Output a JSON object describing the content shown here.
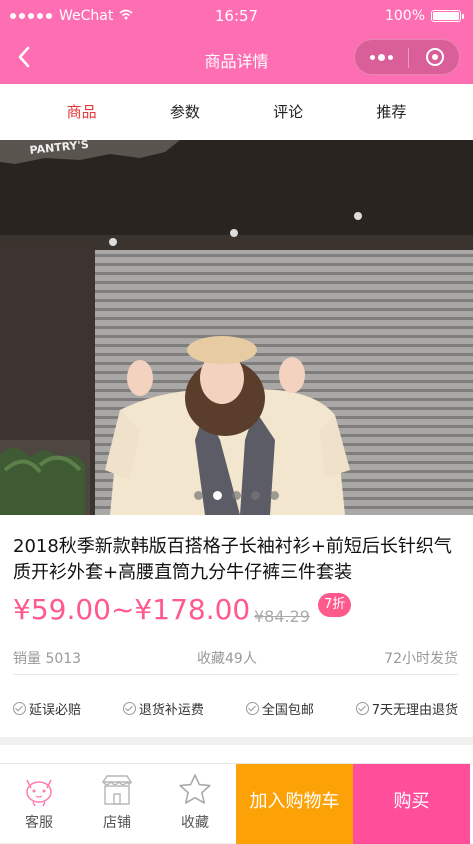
{
  "status": {
    "carrier": "WeChat",
    "time": "16:57",
    "battery": "100%"
  },
  "nav": {
    "title": "商品详情"
  },
  "tabs": [
    {
      "label": "商品"
    },
    {
      "label": "参数"
    },
    {
      "label": "评论"
    },
    {
      "label": "推荐"
    }
  ],
  "carousel": {
    "image_sign_text": "PANTRY'S",
    "slide_count": 5,
    "active_index": 1
  },
  "product": {
    "title": "2018秋季新款韩版百搭格子长袖衬衫+前短后长针织气质开衫外套+高腰直筒九分牛仔裤三件套装",
    "price": "¥59.00~¥178.00",
    "old_price": "¥84.29",
    "discount": "7折",
    "sales": "销量 5013",
    "favorites": "收藏49人",
    "shipping": "72小时发货"
  },
  "guarantees": [
    "延误必赔",
    "退货补运费",
    "全国包邮",
    "7天无理由退货"
  ],
  "bottom": {
    "service": "客服",
    "shop": "店铺",
    "favorite": "收藏",
    "add_to_cart": "加入购物车",
    "buy": "购买"
  },
  "colors": {
    "brand": "#fe6eb2",
    "price": "#ff5a8c",
    "cart": "#fda206",
    "buy": "#ff4f9b",
    "active_tab": "#e4383a"
  }
}
